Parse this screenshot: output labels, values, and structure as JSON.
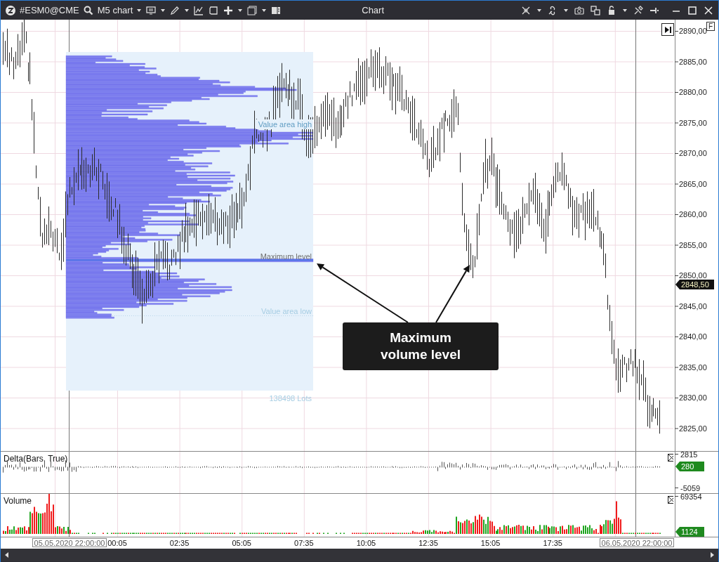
{
  "toolbar": {
    "symbol": "#ESM0@CME",
    "chart_menu": "M5 chart"
  },
  "window": {
    "title": "Chart"
  },
  "price_axis": {
    "labels": [
      "2890,00",
      "2885,00",
      "2880,00",
      "2875,00",
      "2870,00",
      "2865,00",
      "2860,00",
      "2855,00",
      "2850,00",
      "2845,00",
      "2840,00",
      "2835,00",
      "2830,00",
      "2825,00"
    ],
    "last_price": "2848,50",
    "corner_mark": "F"
  },
  "profile": {
    "value_area_high": "Value area high",
    "maximum_level": "Maximum level",
    "value_area_low": "Value area low",
    "total": "138498 Lots"
  },
  "callout": {
    "text": "Maximum\nvolume level"
  },
  "delta": {
    "title": "Delta(Bars, True)",
    "max": "2815",
    "min": "-5059",
    "last": "280"
  },
  "volume": {
    "title": "Volume",
    "max": "69354",
    "last": "1124"
  },
  "time_axis": {
    "start": "05.05.2020 22:00:00",
    "labels": [
      "00:05",
      "02:35",
      "05:05",
      "07:35",
      "10:05",
      "12:35",
      "15:05",
      "17:35"
    ],
    "end": "06.05.2020 22:00:00"
  }
}
